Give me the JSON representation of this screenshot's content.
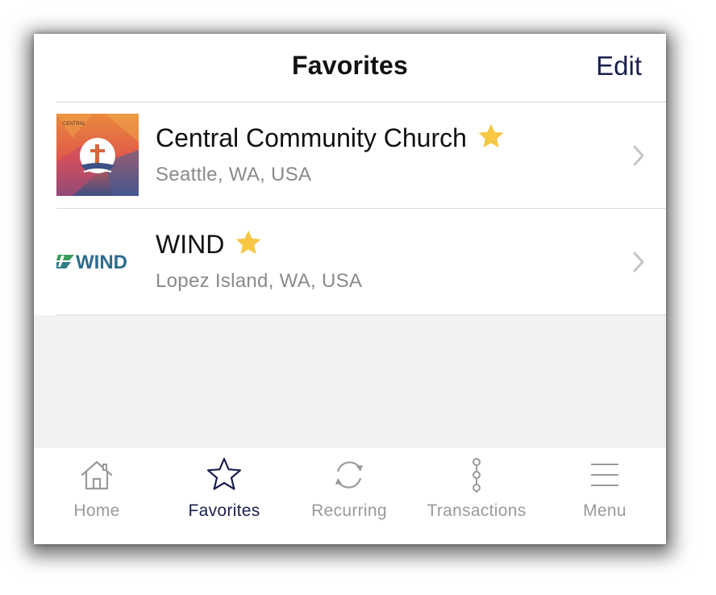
{
  "header": {
    "title": "Favorites",
    "edit_label": "Edit"
  },
  "favorites": [
    {
      "name": "Central Community Church",
      "location": "Seattle, WA, USA",
      "logo_icon": "church-cross-logo",
      "starred": true
    },
    {
      "name": "WIND",
      "location": "Lopez Island, WA, USA",
      "logo_icon": "wind-logo",
      "logo_text": "WIND",
      "starred": true
    }
  ],
  "tabbar": {
    "tabs": [
      {
        "label": "Home",
        "icon": "home-icon",
        "active": false
      },
      {
        "label": "Favorites",
        "icon": "star-icon",
        "active": true
      },
      {
        "label": "Recurring",
        "icon": "recurring-icon",
        "active": false
      },
      {
        "label": "Transactions",
        "icon": "transactions-icon",
        "active": false
      },
      {
        "label": "Menu",
        "icon": "menu-icon",
        "active": false
      }
    ]
  },
  "colors": {
    "accent": "#1a1f4d",
    "star": "#f6c744",
    "inactive_tab": "#9a9a9a",
    "subtitle": "#8a8a8a"
  }
}
